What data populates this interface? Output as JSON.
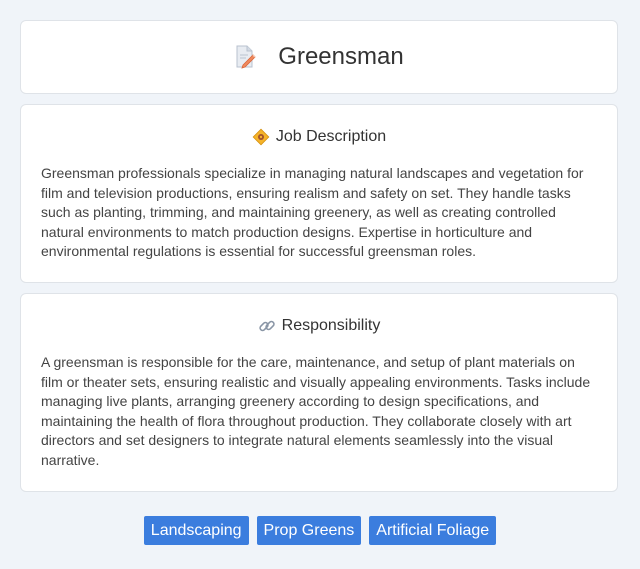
{
  "header": {
    "title": "Greensman",
    "icon": "document-pencil-icon"
  },
  "sections": [
    {
      "icon": "diamond-badge-icon",
      "title": "Job Description",
      "body": "Greensman professionals specialize in managing natural landscapes and vegetation for film and television productions, ensuring realism and safety on set. They handle tasks such as planting, trimming, and maintaining greenery, as well as creating controlled natural environments to match production designs. Expertise in horticulture and environmental regulations is essential for successful greensman roles."
    },
    {
      "icon": "link-icon",
      "title": "Responsibility",
      "body": "A greensman is responsible for the care, maintenance, and setup of plant materials on film or theater sets, ensuring realistic and visually appealing environments. Tasks include managing live plants, arranging greenery according to design specifications, and maintaining the health of flora throughout production. They collaborate closely with art directors and set designers to integrate natural elements seamlessly into the visual narrative."
    }
  ],
  "tags": [
    "Landscaping",
    "Prop Greens",
    "Artificial Foliage"
  ],
  "colors": {
    "background": "#f0f4f9",
    "card": "#ffffff",
    "tag": "#3b7dde",
    "text": "#444444"
  }
}
